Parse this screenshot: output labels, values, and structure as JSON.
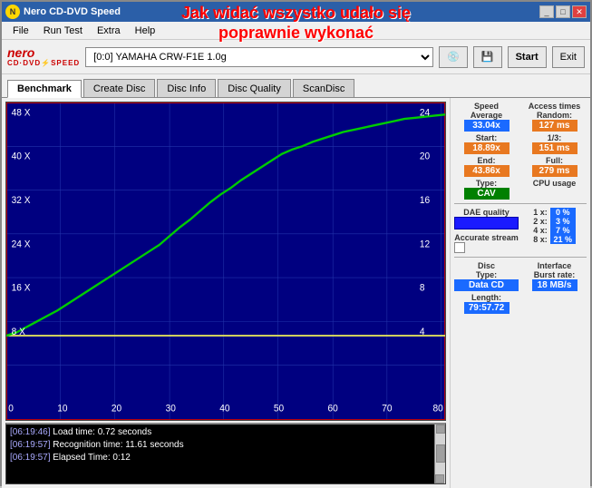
{
  "window": {
    "title": "Nero CD-DVD Speed",
    "overlay_line1": "Jak widać wszystko udało się",
    "overlay_line2": "poprawnie  wykonać"
  },
  "menu": {
    "items": [
      "File",
      "Run Test",
      "Extra",
      "Help"
    ]
  },
  "header": {
    "drive_label": "[0:0]  YAMAHA CRW-F1E 1.0g",
    "start_btn": "Start",
    "exit_btn": "Exit"
  },
  "tabs": {
    "items": [
      "Benchmark",
      "Create Disc",
      "Disc Info",
      "Disc Quality",
      "ScanDisc"
    ],
    "active": "Benchmark"
  },
  "chart": {
    "y_left_labels": [
      "48 X",
      "40 X",
      "32 X",
      "24 X",
      "16 X",
      "8 X",
      ""
    ],
    "y_right_labels": [
      "24",
      "20",
      "16",
      "12",
      "8",
      "4",
      ""
    ],
    "x_labels": [
      "0",
      "10",
      "20",
      "30",
      "40",
      "50",
      "60",
      "70",
      "80"
    ]
  },
  "stats": {
    "speed_label": "Speed",
    "average_label": "Average",
    "average_val": "33.04x",
    "start_label": "Start:",
    "start_val": "18.89x",
    "end_label": "End:",
    "end_val": "43.86x",
    "type_label": "Type:",
    "type_val": "CAV",
    "access_times_label": "Access times",
    "random_label": "Random:",
    "random_val": "127 ms",
    "one_third_label": "1/3:",
    "one_third_val": "151 ms",
    "full_label": "Full:",
    "full_val": "279 ms",
    "cpu_usage_label": "CPU usage",
    "cpu_1x_label": "1 x:",
    "cpu_1x_val": "0 %",
    "cpu_2x_label": "2 x:",
    "cpu_2x_val": "3 %",
    "cpu_4x_label": "4 x:",
    "cpu_4x_val": "7 %",
    "cpu_8x_label": "8 x:",
    "cpu_8x_val": "21 %",
    "dae_quality_label": "DAE quality",
    "accurate_stream_label": "Accurate stream",
    "disc_label": "Disc",
    "disc_type_label": "Type:",
    "disc_type_val": "Data CD",
    "disc_length_label": "Length:",
    "disc_length_val": "79:57.72",
    "interface_label": "Interface",
    "burst_rate_label": "Burst rate:",
    "burst_rate_val": "18 MB/s"
  },
  "log": {
    "lines": [
      {
        "time": "[06:19:46]",
        "msg": " Load time: 0.72 seconds"
      },
      {
        "time": "[06:19:57]",
        "msg": " Recognition time: 11.61 seconds"
      },
      {
        "time": "[06:19:57]",
        "msg": " Elapsed Time: 0:12"
      }
    ]
  }
}
